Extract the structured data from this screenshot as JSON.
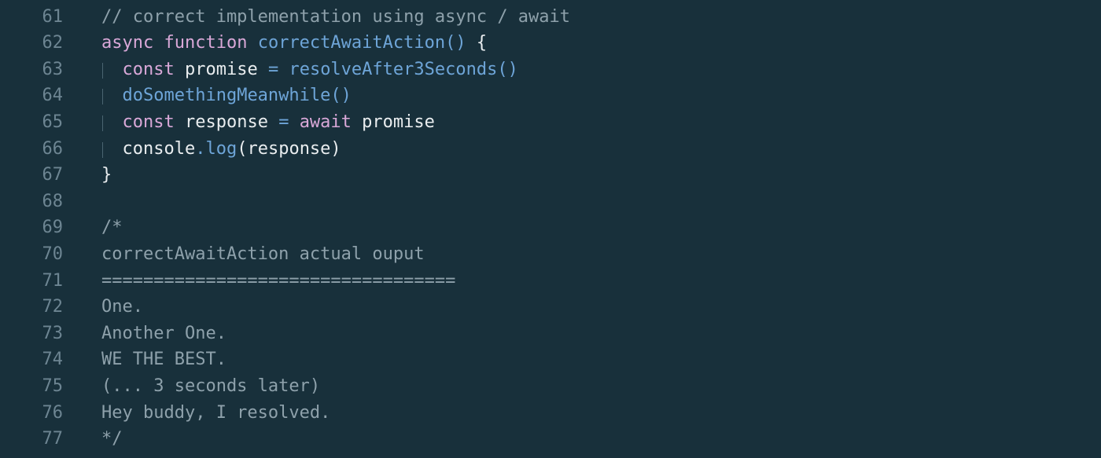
{
  "editor": {
    "language": "javascript",
    "theme_colors": {
      "background": "#18303b",
      "line_number": "#6d8592",
      "comment": "#8ea1ab",
      "keyword": "#d9a8d8",
      "function": "#6ea5d8",
      "text": "#e9edef",
      "indent_guide": "#4a6471"
    },
    "lines": [
      {
        "number": "61",
        "tokens": [
          {
            "type": "comment",
            "text": "// correct implementation using async / await"
          }
        ]
      },
      {
        "number": "62",
        "tokens": [
          {
            "type": "kw",
            "text": "async"
          },
          {
            "type": "plain",
            "text": " "
          },
          {
            "type": "kw",
            "text": "function"
          },
          {
            "type": "plain",
            "text": " "
          },
          {
            "type": "fn",
            "text": "correctAwaitAction"
          },
          {
            "type": "op",
            "text": "()"
          },
          {
            "type": "plain",
            "text": " {"
          }
        ]
      },
      {
        "number": "63",
        "guide": true,
        "tokens": [
          {
            "type": "plain",
            "text": "  "
          },
          {
            "type": "kw",
            "text": "const"
          },
          {
            "type": "plain",
            "text": " promise "
          },
          {
            "type": "op",
            "text": "="
          },
          {
            "type": "plain",
            "text": " "
          },
          {
            "type": "fn",
            "text": "resolveAfter3Seconds"
          },
          {
            "type": "op",
            "text": "()"
          }
        ]
      },
      {
        "number": "64",
        "guide": true,
        "tokens": [
          {
            "type": "plain",
            "text": "  "
          },
          {
            "type": "fn",
            "text": "doSomethingMeanwhile"
          },
          {
            "type": "op",
            "text": "()"
          }
        ]
      },
      {
        "number": "65",
        "guide": true,
        "tokens": [
          {
            "type": "plain",
            "text": "  "
          },
          {
            "type": "kw",
            "text": "const"
          },
          {
            "type": "plain",
            "text": " response "
          },
          {
            "type": "op",
            "text": "="
          },
          {
            "type": "plain",
            "text": " "
          },
          {
            "type": "kw",
            "text": "await"
          },
          {
            "type": "plain",
            "text": " promise"
          }
        ]
      },
      {
        "number": "66",
        "guide": true,
        "tokens": [
          {
            "type": "plain",
            "text": "  console"
          },
          {
            "type": "op",
            "text": "."
          },
          {
            "type": "fn",
            "text": "log"
          },
          {
            "type": "plain",
            "text": "(response)"
          }
        ]
      },
      {
        "number": "67",
        "tokens": [
          {
            "type": "plain",
            "text": "}"
          }
        ]
      },
      {
        "number": "68",
        "tokens": []
      },
      {
        "number": "69",
        "tokens": [
          {
            "type": "comment",
            "text": "/*"
          }
        ]
      },
      {
        "number": "70",
        "tokens": [
          {
            "type": "comment",
            "text": "correctAwaitAction actual ouput"
          }
        ]
      },
      {
        "number": "71",
        "tokens": [
          {
            "type": "comment",
            "text": "=================================="
          }
        ]
      },
      {
        "number": "72",
        "tokens": [
          {
            "type": "comment",
            "text": "One."
          }
        ]
      },
      {
        "number": "73",
        "tokens": [
          {
            "type": "comment",
            "text": "Another One."
          }
        ]
      },
      {
        "number": "74",
        "tokens": [
          {
            "type": "comment",
            "text": "WE THE BEST."
          }
        ]
      },
      {
        "number": "75",
        "tokens": [
          {
            "type": "comment",
            "text": "(... 3 seconds later)"
          }
        ]
      },
      {
        "number": "76",
        "tokens": [
          {
            "type": "comment",
            "text": "Hey buddy, I resolved."
          }
        ]
      },
      {
        "number": "77",
        "tokens": [
          {
            "type": "comment",
            "text": "*/"
          }
        ]
      }
    ]
  }
}
